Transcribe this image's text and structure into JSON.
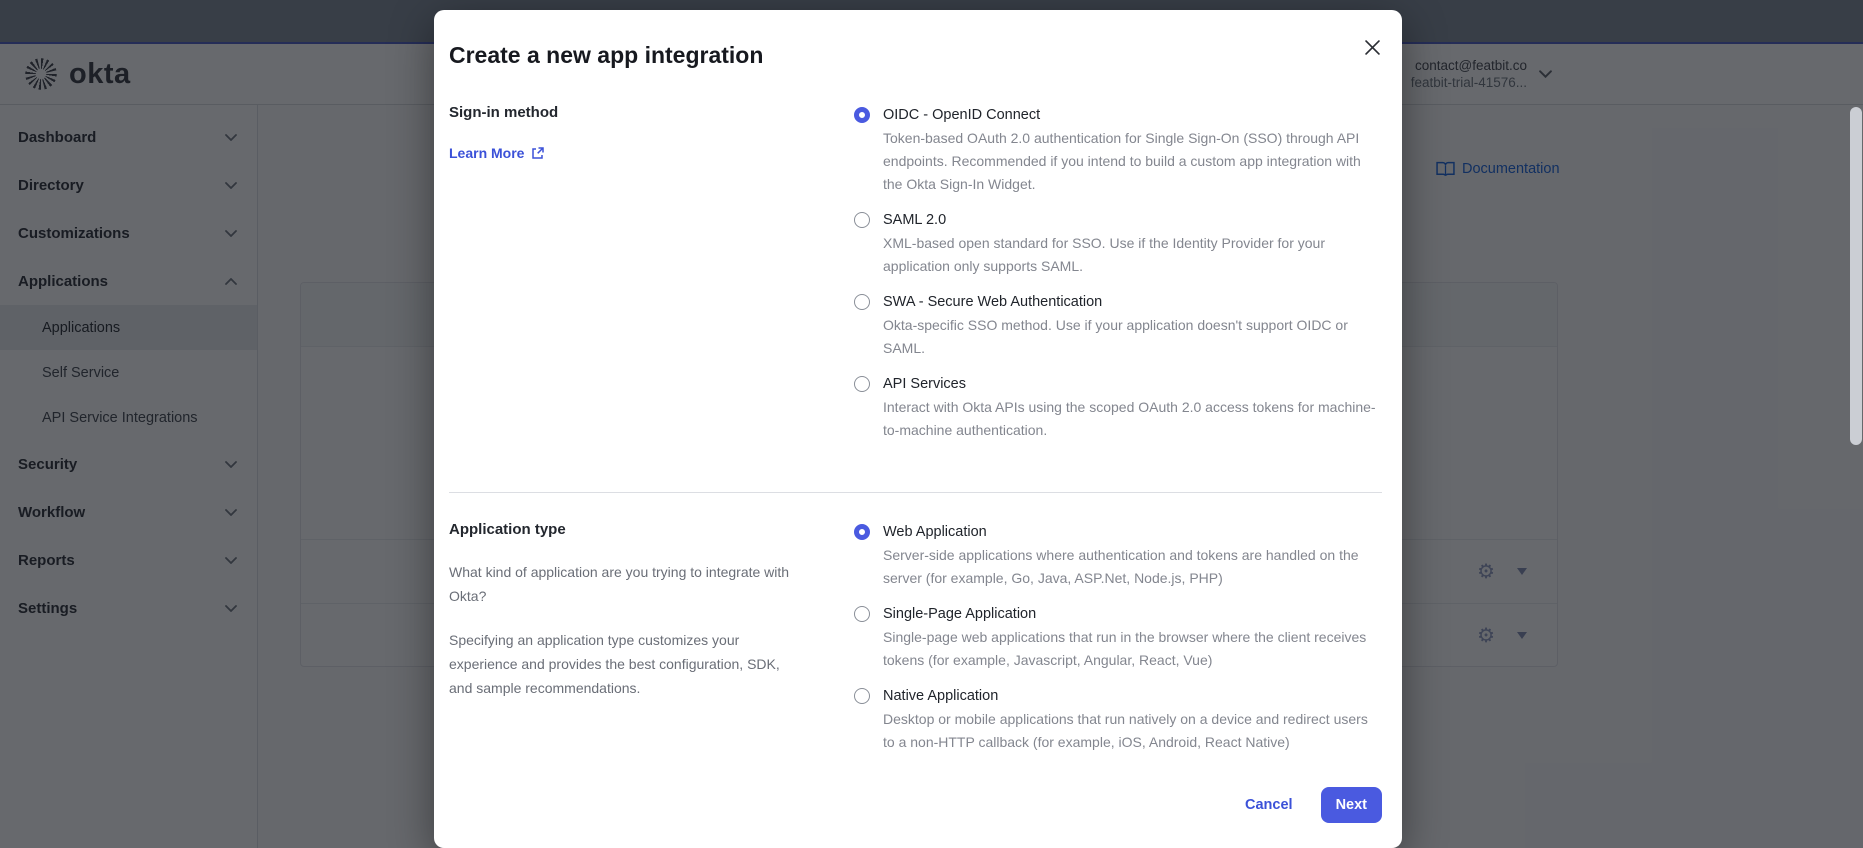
{
  "topbar": {
    "brand": "okta",
    "account": {
      "email": "contact@featbit.co",
      "org": "featbit-trial-41576..."
    }
  },
  "sidebar": {
    "items": [
      {
        "label": "Dashboard",
        "expanded": false
      },
      {
        "label": "Directory",
        "expanded": false
      },
      {
        "label": "Customizations",
        "expanded": false
      },
      {
        "label": "Applications",
        "expanded": true,
        "children": [
          {
            "label": "Applications",
            "active": true
          },
          {
            "label": "Self Service",
            "active": false
          },
          {
            "label": "API Service Integrations",
            "active": false
          }
        ]
      },
      {
        "label": "Security",
        "expanded": false
      },
      {
        "label": "Workflow",
        "expanded": false
      },
      {
        "label": "Reports",
        "expanded": false
      },
      {
        "label": "Settings",
        "expanded": false
      }
    ]
  },
  "content": {
    "documentation_label": "Documentation"
  },
  "modal": {
    "title": "Create a new app integration",
    "signin": {
      "label": "Sign-in method",
      "learn_more_label": "Learn More",
      "options": [
        {
          "name": "OIDC - OpenID Connect",
          "description": "Token-based OAuth 2.0 authentication for Single Sign-On (SSO) through API endpoints. Recommended if you intend to build a custom app integration with the Okta Sign-In Widget.",
          "selected": true
        },
        {
          "name": "SAML 2.0",
          "description": "XML-based open standard for SSO. Use if the Identity Provider for your application only supports SAML.",
          "selected": false
        },
        {
          "name": "SWA - Secure Web Authentication",
          "description": "Okta-specific SSO method. Use if your application doesn't support OIDC or SAML.",
          "selected": false
        },
        {
          "name": "API Services",
          "description": "Interact with Okta APIs using the scoped OAuth 2.0 access tokens for machine-to-machine authentication.",
          "selected": false
        }
      ]
    },
    "apptype": {
      "label": "Application type",
      "help1": "What kind of application are you trying to integrate with Okta?",
      "help2": "Specifying an application type customizes your experience and provides the best configuration, SDK, and sample recommendations.",
      "options": [
        {
          "name": "Web Application",
          "description": "Server-side applications where authentication and tokens are handled on the server (for example, Go, Java, ASP.Net, Node.js, PHP)",
          "selected": true
        },
        {
          "name": "Single-Page Application",
          "description": "Single-page web applications that run in the browser where the client receives tokens (for example, Javascript, Angular, React, Vue)",
          "selected": false
        },
        {
          "name": "Native Application",
          "description": "Desktop or mobile applications that run natively on a device and redirect users to a non-HTTP callback (for example, iOS, Android, React Native)",
          "selected": false
        }
      ]
    },
    "footer": {
      "cancel_label": "Cancel",
      "next_label": "Next"
    }
  },
  "icons": {
    "gear": "⚙"
  },
  "colors": {
    "accent": "#4a5ae0",
    "link": "#3b51d8",
    "doc_link": "#1662dd"
  }
}
